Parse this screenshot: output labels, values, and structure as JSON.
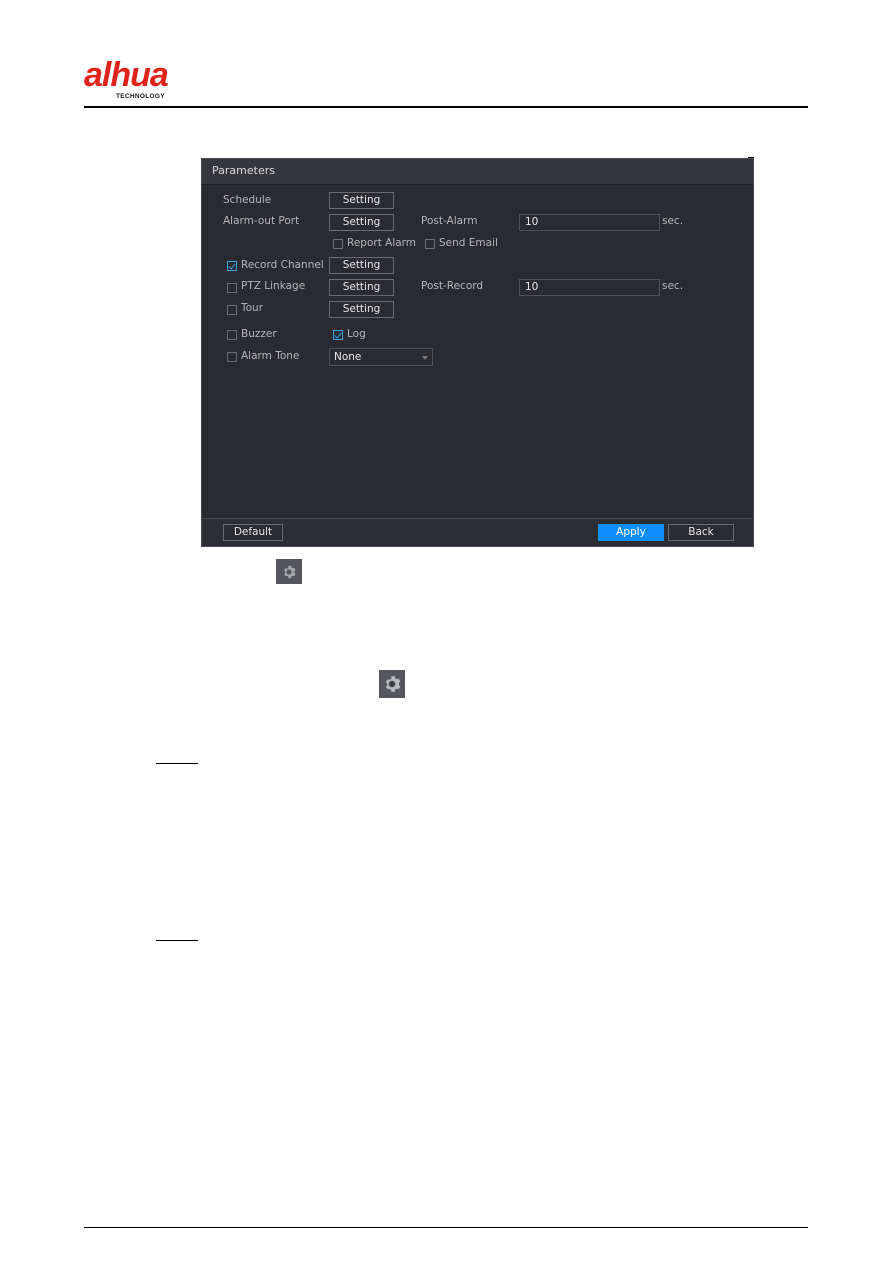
{
  "brand": {
    "logo_text": "alhua",
    "logo_subtext": "TECHNOLOGY",
    "logo_color": "#e0241b"
  },
  "panel": {
    "title": "Parameters",
    "rows": {
      "schedule": {
        "label": "Schedule",
        "button": "Setting"
      },
      "alarm_out_port": {
        "label": "Alarm-out Port",
        "button": "Setting"
      },
      "post_alarm": {
        "label": "Post-Alarm",
        "value": "10",
        "unit": "sec."
      },
      "report_alarm": {
        "label": "Report Alarm",
        "checked": false
      },
      "send_email": {
        "label": "Send Email",
        "checked": false
      },
      "record_channel": {
        "label": "Record Channel",
        "checked": true,
        "button": "Setting"
      },
      "ptz_linkage": {
        "label": "PTZ Linkage",
        "checked": false,
        "button": "Setting"
      },
      "post_record": {
        "label": "Post-Record",
        "value": "10",
        "unit": "sec."
      },
      "tour": {
        "label": "Tour",
        "checked": false,
        "button": "Setting"
      },
      "buzzer": {
        "label": "Buzzer",
        "checked": false
      },
      "log": {
        "label": "Log",
        "checked": true
      },
      "alarm_tone": {
        "label": "Alarm Tone",
        "checked": false,
        "selected": "None"
      }
    },
    "footer": {
      "default_label": "Default",
      "apply_label": "Apply",
      "back_label": "Back"
    },
    "accent_color": "#0f8fff"
  },
  "icons": {
    "inline_gear_1": "gear-icon",
    "inline_gear_2": "gear-icon"
  }
}
